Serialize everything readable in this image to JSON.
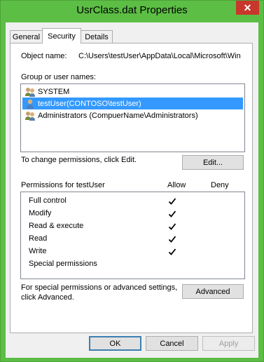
{
  "window": {
    "title": "UsrClass.dat Properties",
    "close_glyph": "✕"
  },
  "tabs": [
    {
      "label": "General"
    },
    {
      "label": "Security"
    },
    {
      "label": "Details"
    }
  ],
  "object": {
    "label": "Object name:",
    "value": "C:\\Users\\testUser\\AppData\\Local\\Microsoft\\Win"
  },
  "group": {
    "label": "Group or user names:",
    "items": [
      {
        "label": "SYSTEM",
        "icon": "group-users-icon"
      },
      {
        "label": "testUser(CONTOSO\\testUser)",
        "icon": "user-icon",
        "selected": true
      },
      {
        "label": "Administrators (CompuerName\\Administrators)",
        "icon": "group-users-icon"
      }
    ]
  },
  "change": {
    "text": "To change permissions, click Edit.",
    "edit_label": "Edit..."
  },
  "permissions": {
    "label": "Permissions for testUser",
    "allow_header": "Allow",
    "deny_header": "Deny",
    "rows": [
      {
        "name": "Full control",
        "allow": true,
        "deny": false
      },
      {
        "name": "Modify",
        "allow": true,
        "deny": false
      },
      {
        "name": "Read & execute",
        "allow": true,
        "deny": false
      },
      {
        "name": "Read",
        "allow": true,
        "deny": false
      },
      {
        "name": "Write",
        "allow": true,
        "deny": false
      },
      {
        "name": "Special permissions",
        "allow": false,
        "deny": false
      }
    ]
  },
  "advanced": {
    "text_line1": "For special permissions or advanced settings,",
    "text_line2": "click Advanced.",
    "button_label": "Advanced"
  },
  "footer": {
    "ok_label": "OK",
    "cancel_label": "Cancel",
    "apply_label": "Apply"
  },
  "colors": {
    "titlebar": "#5cbe44",
    "close": "#c7372c",
    "selection": "#3399ff"
  }
}
